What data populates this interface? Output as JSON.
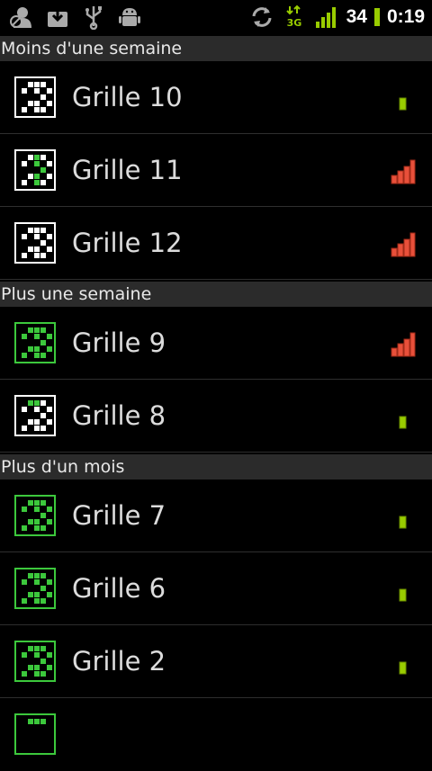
{
  "statusbar": {
    "left_icons": [
      "gmail-contact-icon",
      "download-icon",
      "usb-icon",
      "android-debug-icon"
    ],
    "right_icons": [
      "sync-icon",
      "3g-signal-icon",
      "signal-strength-icon",
      "battery-icon"
    ],
    "battery_level": "34",
    "time": "0:19"
  },
  "colors": {
    "background": "#000000",
    "section_background": "#2b2b2b",
    "green_grid": "#3cc83c",
    "white_grid": "#ffffff",
    "difficulty_red": "#e8503a",
    "difficulty_green": "#99cc00"
  },
  "sections": [
    {
      "title": "Moins d'une semaine"
    },
    {
      "title": "Plus une semaine"
    },
    {
      "title": "Plus d'un mois"
    }
  ],
  "rows": [
    {
      "label": "Grille 10",
      "thumb_style": "white",
      "difficulty": "easy"
    },
    {
      "label": "Grille 11",
      "thumb_style": "white-partial",
      "difficulty": "hard"
    },
    {
      "label": "Grille 12",
      "thumb_style": "white",
      "difficulty": "hard"
    },
    {
      "label": "Grille 9",
      "thumb_style": "green",
      "difficulty": "hard"
    },
    {
      "label": "Grille 8",
      "thumb_style": "white-green-top",
      "difficulty": "easy"
    },
    {
      "label": "Grille 7",
      "thumb_style": "green",
      "difficulty": "easy"
    },
    {
      "label": "Grille 6",
      "thumb_style": "green",
      "difficulty": "easy"
    },
    {
      "label": "Grille 2",
      "thumb_style": "green",
      "difficulty": "easy"
    },
    {
      "label": "",
      "thumb_style": "green",
      "difficulty": ""
    }
  ]
}
